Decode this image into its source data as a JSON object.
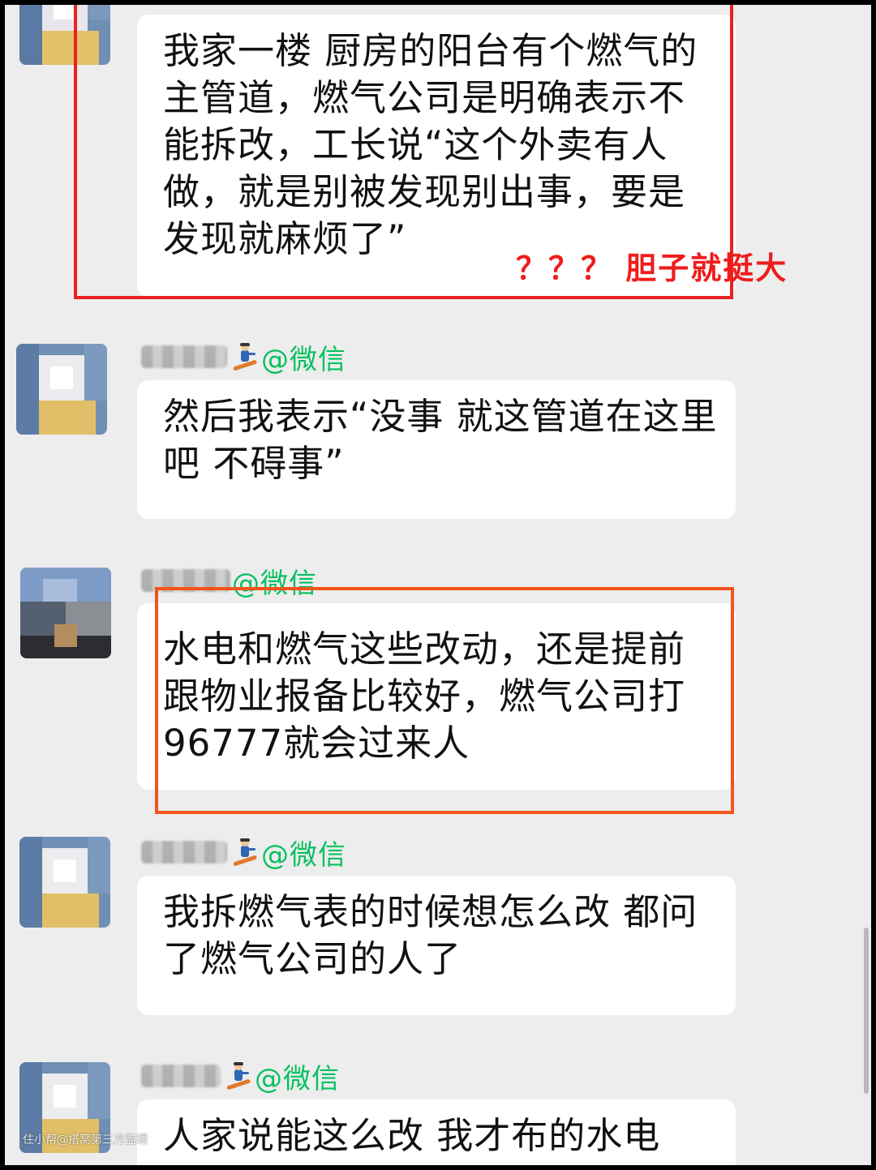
{
  "messages": [
    {
      "text": "我家一楼 厨房的阳台有个燃气的主管道，燃气公司是明确表示不能拆改，工长说“这个外卖有人做，就是别被发现别出事，要是发现就麻烦了”"
    },
    {
      "sender_tag": "@微信",
      "text": "然后我表示“没事 就这管道在这里吧  不碍事”"
    },
    {
      "sender_tag": "@微信",
      "text": "水电和燃气这些改动，还是提前跟物业报备比较好，燃气公司打96777就会过来人"
    },
    {
      "sender_tag": "@微信",
      "text": "我拆燃气表的时候想怎么改 都问了燃气公司的人了"
    },
    {
      "sender_tag": "@微信",
      "text": "人家说能这么改 我才布的水电"
    }
  ],
  "annotation": "？？？ 胆子就挺大",
  "watermark": "住小帮@搭窝第三方监理",
  "icons": {
    "badge": "snowboarder-emoji",
    "avatar": "pixelated-avatar"
  },
  "colors": {
    "chat_background": "#ededed",
    "bubble": "#ffffff",
    "wechat_tag": "#07c160",
    "highlight_red": "#e8231f",
    "highlight_orange": "#f2541b"
  }
}
